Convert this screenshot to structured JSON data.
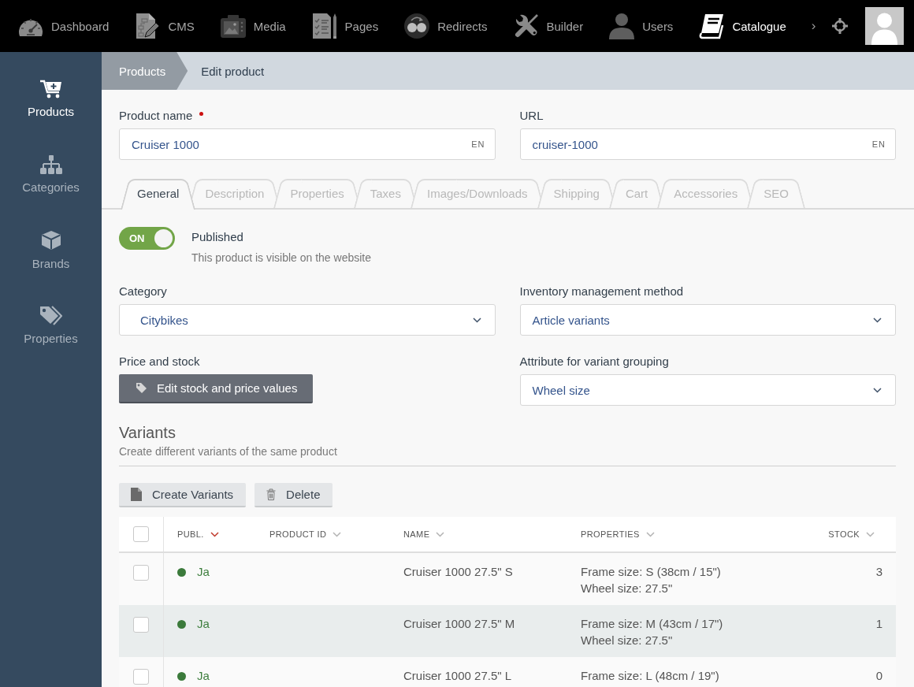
{
  "top_nav": {
    "items": [
      {
        "label": "Dashboard",
        "selected": false
      },
      {
        "label": "CMS",
        "selected": false
      },
      {
        "label": "Media",
        "selected": false
      },
      {
        "label": "Pages",
        "selected": false
      },
      {
        "label": "Redirects",
        "selected": false
      },
      {
        "label": "Builder",
        "selected": false
      },
      {
        "label": "Users",
        "selected": false
      },
      {
        "label": "Catalogue",
        "selected": true
      }
    ],
    "more": "›"
  },
  "sidebar": {
    "items": [
      {
        "label": "Products",
        "selected": true
      },
      {
        "label": "Categories",
        "selected": false
      },
      {
        "label": "Brands",
        "selected": false
      },
      {
        "label": "Properties",
        "selected": false
      }
    ]
  },
  "breadcrumb": [
    "Products",
    "Edit product"
  ],
  "product_name": {
    "label": "Product name",
    "required": true,
    "value": "Cruiser 1000",
    "language": "EN"
  },
  "url": {
    "label": "URL",
    "value": "cruiser-1000",
    "language": "EN"
  },
  "tabs": [
    {
      "label": "General",
      "selected": true
    },
    {
      "label": "Description",
      "selected": false
    },
    {
      "label": "Properties",
      "selected": false
    },
    {
      "label": "Taxes",
      "selected": false
    },
    {
      "label": "Images/Downloads",
      "selected": false
    },
    {
      "label": "Shipping",
      "selected": false
    },
    {
      "label": "Cart",
      "selected": false
    },
    {
      "label": "Accessories",
      "selected": false
    },
    {
      "label": "SEO",
      "selected": false
    }
  ],
  "published": {
    "on": true,
    "switch_text": "ON",
    "label": "Published",
    "description": "This product is visible on the website"
  },
  "category": {
    "label": "Category",
    "value": "Citybikes"
  },
  "inventory_method": {
    "label": "Inventory management method",
    "value": "Article variants"
  },
  "price_and_stock": {
    "label": "Price and stock",
    "button": "Edit stock and price values"
  },
  "variant_grouping": {
    "label": "Attribute for variant grouping",
    "value": "Wheel size"
  },
  "variants": {
    "title": "Variants",
    "subtitle": "Create different variants of the same product",
    "actions": [
      {
        "label": "Create Variants",
        "kind": "create"
      },
      {
        "label": "Delete",
        "kind": "delete"
      }
    ],
    "table": {
      "all_checked": false,
      "columns": [
        {
          "label": "PUBL.",
          "sorted": true
        },
        {
          "label": "PRODUCT ID",
          "sorted": false
        },
        {
          "label": "NAME",
          "sorted": false
        },
        {
          "label": "PROPERTIES",
          "sorted": false
        },
        {
          "label": "STOCK",
          "sorted": false
        }
      ],
      "rows": [
        {
          "checked": false,
          "published": true,
          "status": "Ja",
          "name": "Cruiser 1000 27.5\" S",
          "properties": [
            "Frame size: S (38cm / 15\")",
            "Wheel size: 27.5\""
          ],
          "stock": "3"
        },
        {
          "checked": false,
          "published": true,
          "status": "Ja",
          "name": "Cruiser 1000 27.5\" M",
          "properties": [
            "Frame size: M (43cm / 17\")",
            "Wheel size: 27.5\""
          ],
          "stock": "1"
        },
        {
          "checked": false,
          "published": true,
          "status": "Ja",
          "name": "Cruiser 1000 27.5\" L",
          "properties": [
            "Frame size: L (48cm / 19\")"
          ],
          "stock": "0"
        }
      ]
    }
  }
}
